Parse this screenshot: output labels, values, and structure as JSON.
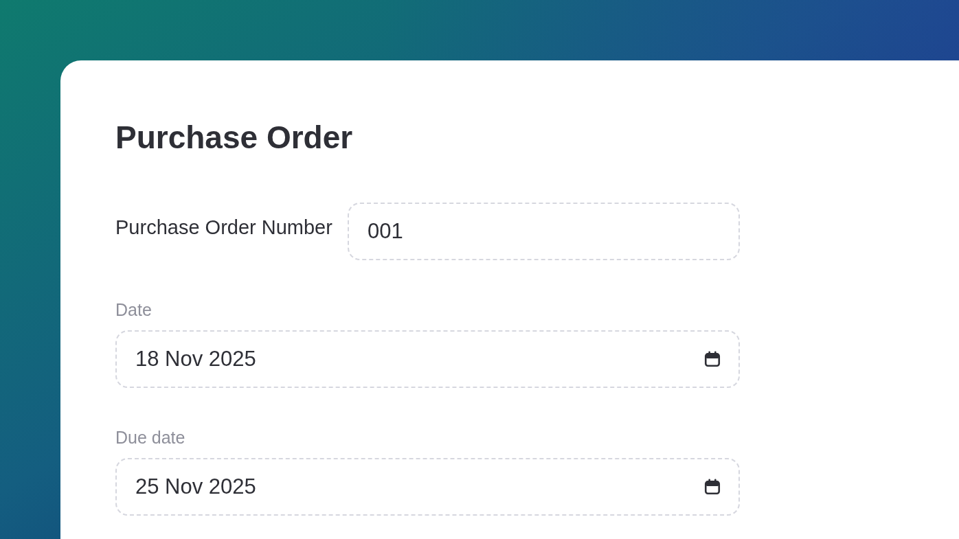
{
  "title": "Purchase Order",
  "fields": [
    {
      "kind": "inline",
      "label": "Purchase Order Number",
      "value": "001"
    },
    {
      "kind": "date",
      "label": "Date",
      "value": "18 Nov 2025"
    },
    {
      "kind": "date",
      "label": "Due date",
      "value": "25 Nov 2025"
    }
  ]
}
